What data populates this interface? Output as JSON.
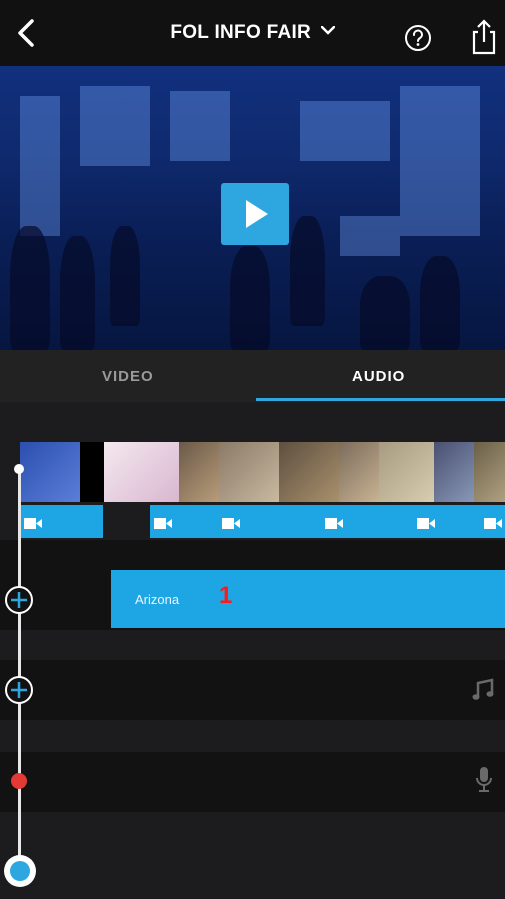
{
  "header": {
    "title": "FOL INFO  FAIR",
    "back_icon": "chevron-left-icon",
    "dropdown_icon": "chevron-down-icon",
    "help_icon": "question-circle-icon",
    "share_icon": "share-icon"
  },
  "preview": {
    "play_icon": "play-icon",
    "expand_icon": "expand-icon"
  },
  "tabs": [
    {
      "label": "VIDEO",
      "active": false
    },
    {
      "label": "AUDIO",
      "active": true
    }
  ],
  "timeline": {
    "audio_clip": {
      "label": "Arizona"
    },
    "marker_number": "1",
    "music_icon": "music-note-icon",
    "mic_icon": "microphone-icon",
    "add_icon": "plus-circle-icon"
  },
  "colors": {
    "accent": "#2ea7e0",
    "clip": "#1ea5e3",
    "marker": "#ff1a1a",
    "record": "#e53935"
  }
}
